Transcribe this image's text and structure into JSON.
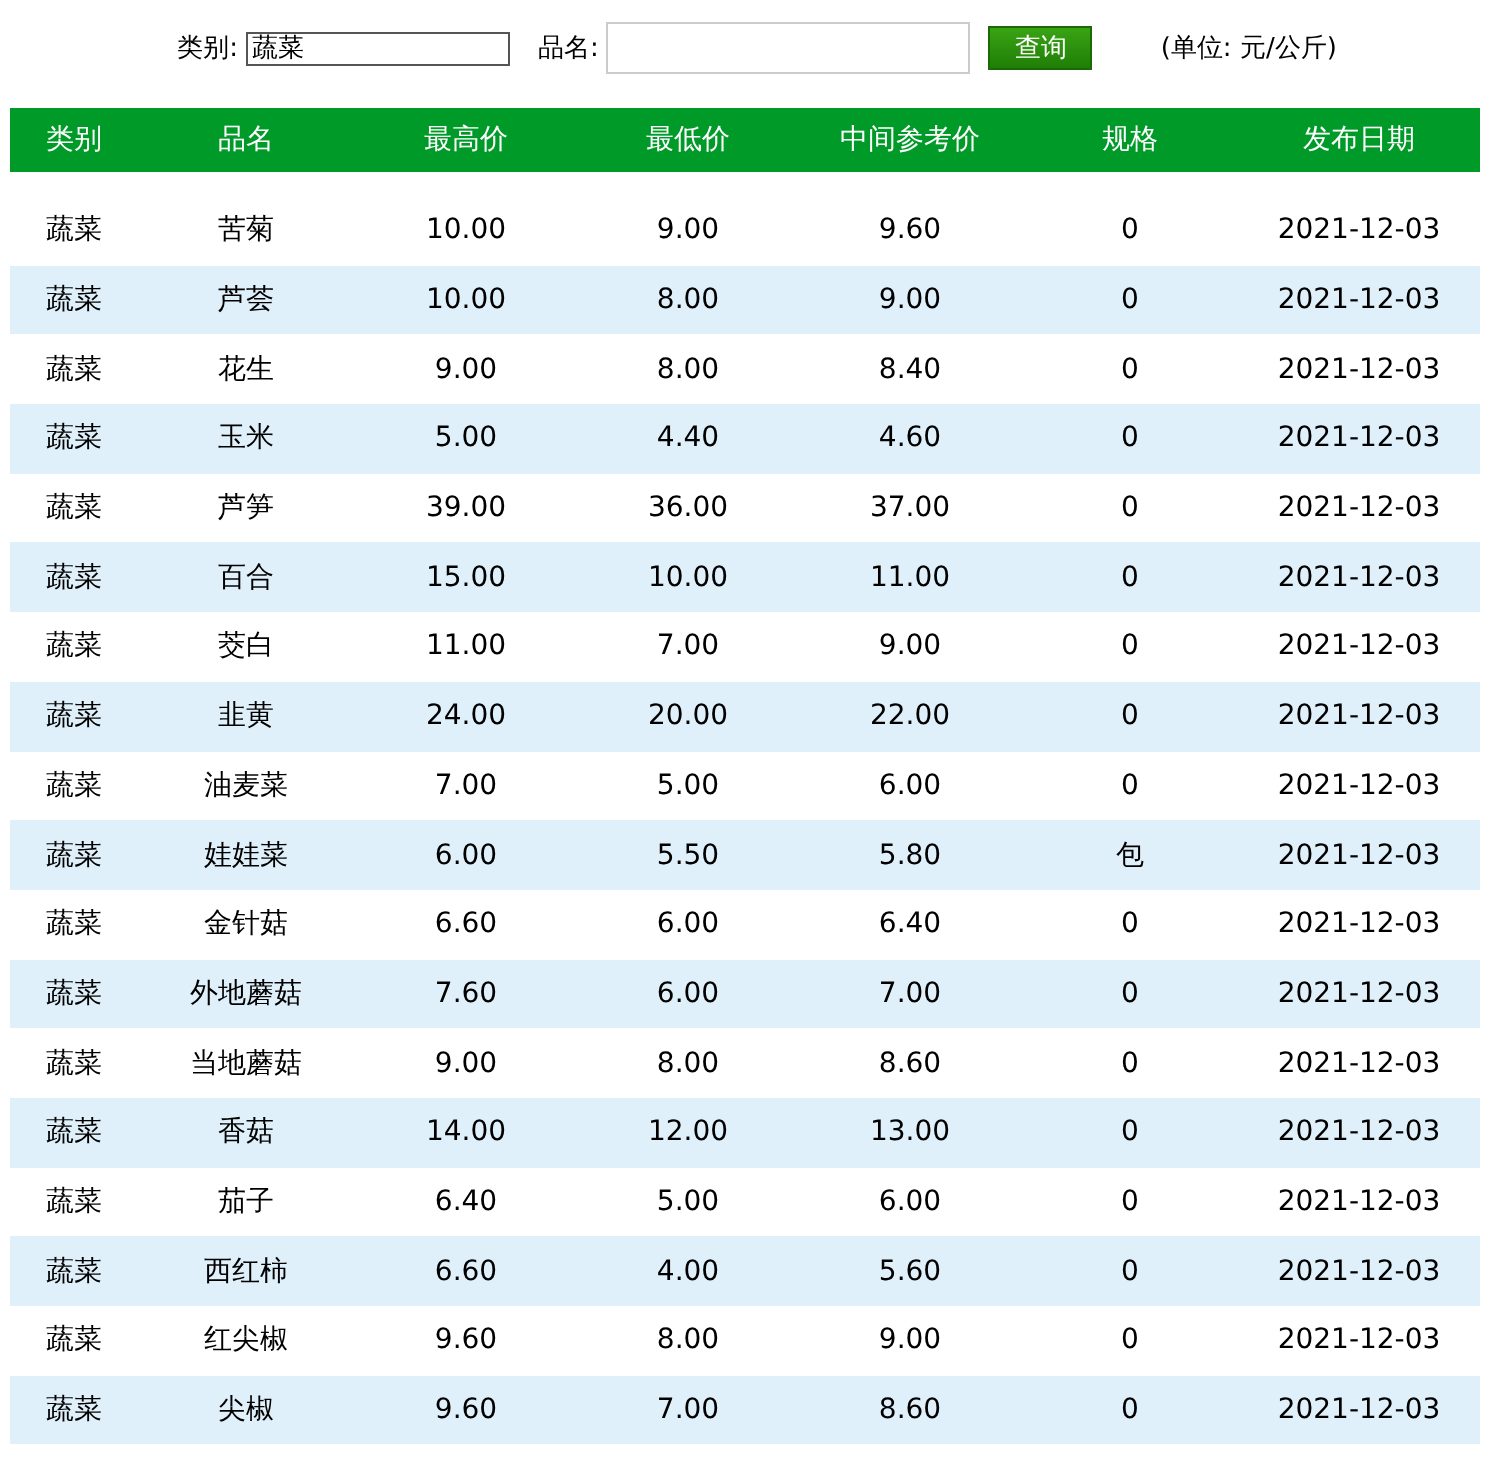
{
  "search": {
    "category_label": "类别:",
    "category_value": "蔬菜",
    "name_label": "品名:",
    "button": "查询",
    "unit": "(单位:  元/公斤)"
  },
  "table": {
    "columns": [
      "类别",
      "品名",
      "最高价",
      "最低价",
      "中间参考价",
      "规格",
      "发布日期"
    ],
    "rows": [
      [
        "蔬菜",
        "苦菊",
        "10.00",
        "9.00",
        "9.60",
        "0",
        "2021-12-03"
      ],
      [
        "蔬菜",
        "芦荟",
        "10.00",
        "8.00",
        "9.00",
        "0",
        "2021-12-03"
      ],
      [
        "蔬菜",
        "花生",
        "9.00",
        "8.00",
        "8.40",
        "0",
        "2021-12-03"
      ],
      [
        "蔬菜",
        "玉米",
        "5.00",
        "4.40",
        "4.60",
        "0",
        "2021-12-03"
      ],
      [
        "蔬菜",
        "芦笋",
        "39.00",
        "36.00",
        "37.00",
        "0",
        "2021-12-03"
      ],
      [
        "蔬菜",
        "百合",
        "15.00",
        "10.00",
        "11.00",
        "0",
        "2021-12-03"
      ],
      [
        "蔬菜",
        "茭白",
        "11.00",
        "7.00",
        "9.00",
        "0",
        "2021-12-03"
      ],
      [
        "蔬菜",
        "韭黄",
        "24.00",
        "20.00",
        "22.00",
        "0",
        "2021-12-03"
      ],
      [
        "蔬菜",
        "油麦菜",
        "7.00",
        "5.00",
        "6.00",
        "0",
        "2021-12-03"
      ],
      [
        "蔬菜",
        "娃娃菜",
        "6.00",
        "5.50",
        "5.80",
        "包",
        "2021-12-03"
      ],
      [
        "蔬菜",
        "金针菇",
        "6.60",
        "6.00",
        "6.40",
        "0",
        "2021-12-03"
      ],
      [
        "蔬菜",
        "外地蘑菇",
        "7.60",
        "6.00",
        "7.00",
        "0",
        "2021-12-03"
      ],
      [
        "蔬菜",
        "当地蘑菇",
        "9.00",
        "8.00",
        "8.60",
        "0",
        "2021-12-03"
      ],
      [
        "蔬菜",
        "香菇",
        "14.00",
        "12.00",
        "13.00",
        "0",
        "2021-12-03"
      ],
      [
        "蔬菜",
        "茄子",
        "6.40",
        "5.00",
        "6.00",
        "0",
        "2021-12-03"
      ],
      [
        "蔬菜",
        "西红柿",
        "6.60",
        "4.00",
        "5.60",
        "0",
        "2021-12-03"
      ],
      [
        "蔬菜",
        "红尖椒",
        "9.60",
        "8.00",
        "9.00",
        "0",
        "2021-12-03"
      ],
      [
        "蔬菜",
        "尖椒",
        "9.60",
        "7.00",
        "8.60",
        "0",
        "2021-12-03"
      ]
    ]
  }
}
